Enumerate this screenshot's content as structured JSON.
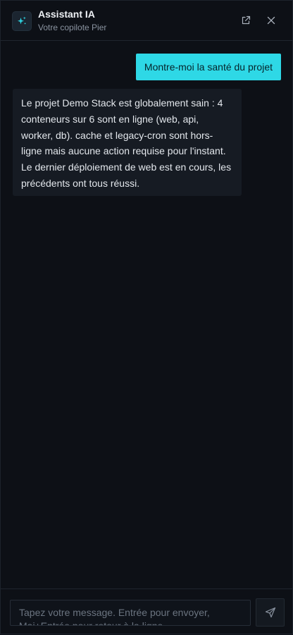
{
  "header": {
    "title": "Assistant IA",
    "subtitle": "Votre copilote Pier",
    "icons": {
      "logo": "sparkles-icon",
      "open": "external-link-icon",
      "close": "close-icon"
    }
  },
  "messages": [
    {
      "role": "user",
      "text": "Montre-moi la santé du projet"
    },
    {
      "role": "assistant",
      "text": "Le projet Demo Stack est globalement sain : 4 conteneurs sur 6 sont en ligne (web, api, worker, db). cache et legacy-cron sont hors-ligne mais aucune action requise pour l'instant. Le dernier déploiement de web est en cours, les précédents ont tous réussi."
    }
  ],
  "composer": {
    "placeholder": "Tapez votre message. Entrée pour envoyer, Maj+Entrée pour retour à la ligne",
    "value": "",
    "send_icon": "send-icon"
  },
  "colors": {
    "accent": "#2ed8e6",
    "background": "#0d1016",
    "bubble_assistant": "#161b23"
  }
}
